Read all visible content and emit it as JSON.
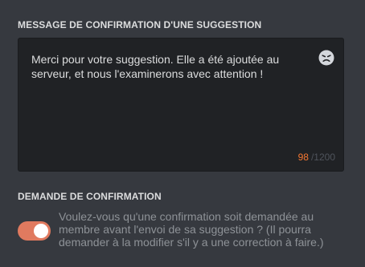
{
  "message_section": {
    "title": "MESSAGE DE CONFIRMATION D'UNE SUGGESTION",
    "text": "Merci pour votre suggestion. Elle a été ajoutée au serveur, et nous l'examinerons avec attention !",
    "emoji_icon": "sad-face-emoji-icon",
    "char_count": "98",
    "char_max": "/1200"
  },
  "confirm_section": {
    "title": "DEMANDE DE CONFIRMATION",
    "toggle_on": true,
    "description": "Voulez-vous qu'une confirmation soit demandée au membre avant l'envoi de sa suggestion ? (Il pourra demander à la modifier s'il y a une correction à faire.)"
  },
  "colors": {
    "background": "#36393f",
    "input_bg": "#202225",
    "toggle_on": "#e07a5f",
    "counter_current": "#f57731"
  }
}
